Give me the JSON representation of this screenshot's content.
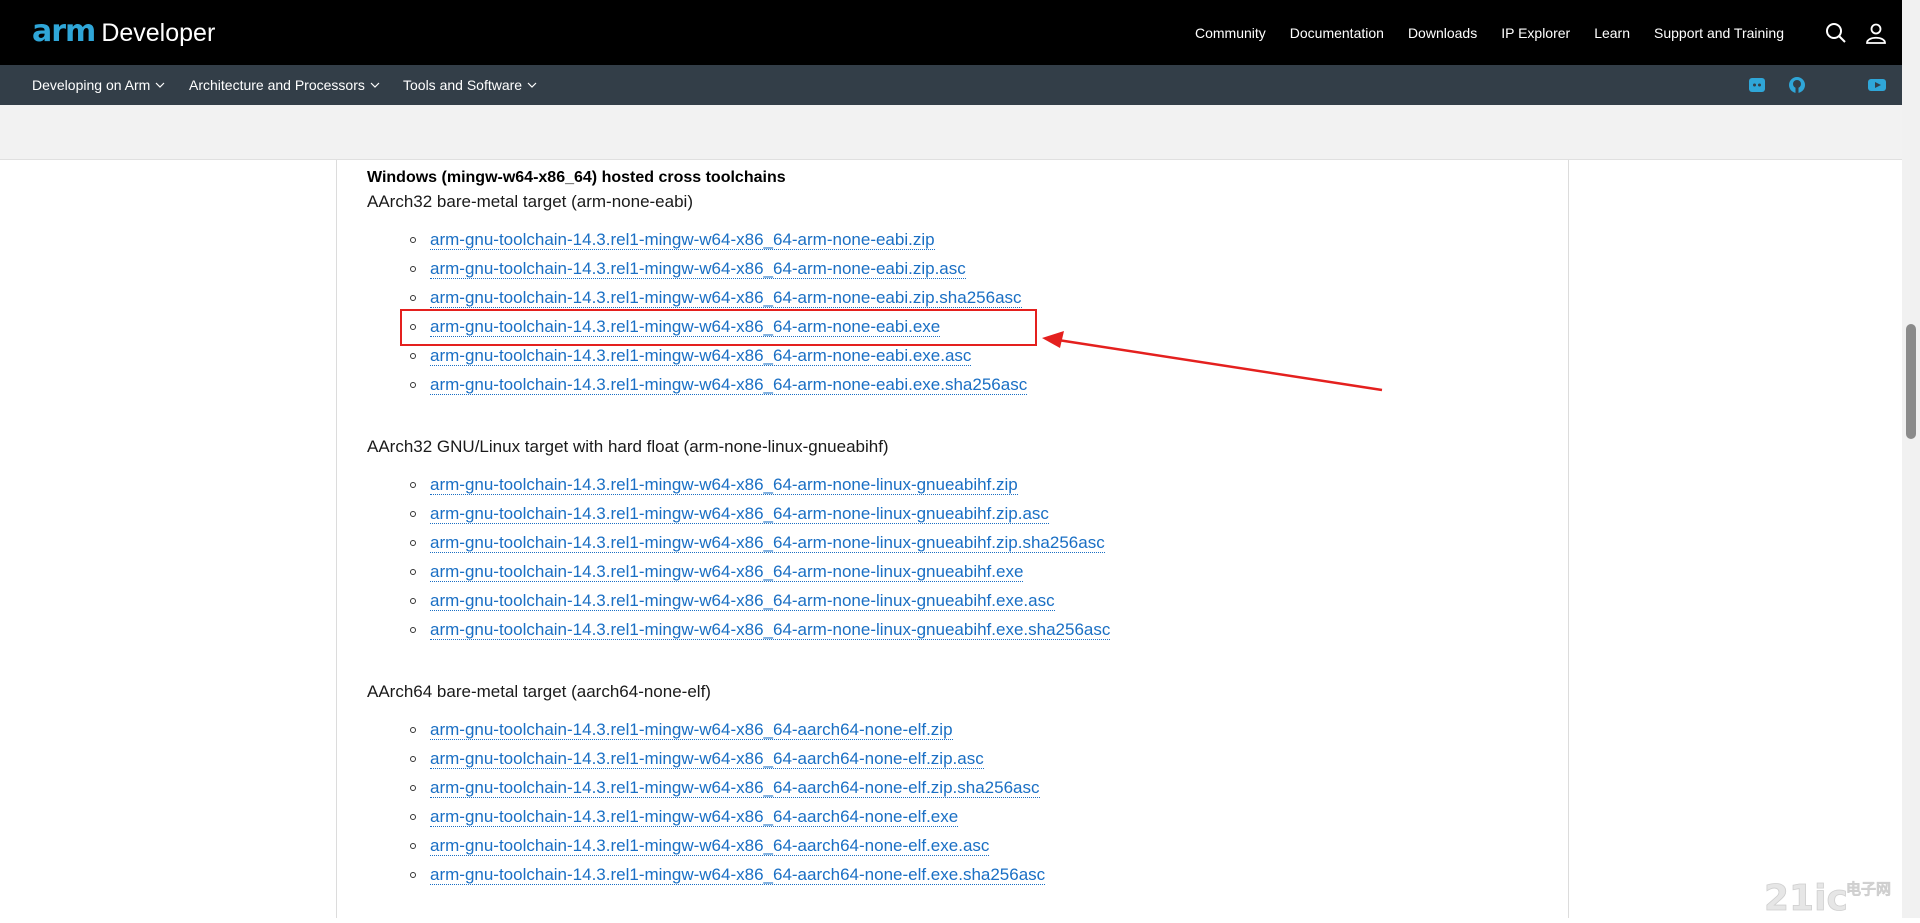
{
  "header": {
    "logo_brand": "arm",
    "logo_product": "Developer",
    "nav": [
      "Community",
      "Documentation",
      "Downloads",
      "IP Explorer",
      "Learn",
      "Support and Training"
    ],
    "icons": [
      "search-icon",
      "user-icon"
    ]
  },
  "subnav": {
    "items": [
      "Developing on Arm",
      "Architecture and Processors",
      "Tools and Software"
    ],
    "social_icons": [
      "discord-icon",
      "github-icon",
      "youtube-icon"
    ]
  },
  "content": {
    "section_title": "Windows (mingw-w64-x86_64) hosted cross toolchains",
    "groups": [
      {
        "title": "AArch32 bare-metal target (arm-none-eabi)",
        "links": [
          "arm-gnu-toolchain-14.3.rel1-mingw-w64-x86_64-arm-none-eabi.zip",
          "arm-gnu-toolchain-14.3.rel1-mingw-w64-x86_64-arm-none-eabi.zip.asc",
          "arm-gnu-toolchain-14.3.rel1-mingw-w64-x86_64-arm-none-eabi.zip.sha256asc",
          "arm-gnu-toolchain-14.3.rel1-mingw-w64-x86_64-arm-none-eabi.exe",
          "arm-gnu-toolchain-14.3.rel1-mingw-w64-x86_64-arm-none-eabi.exe.asc",
          "arm-gnu-toolchain-14.3.rel1-mingw-w64-x86_64-arm-none-eabi.exe.sha256asc"
        ]
      },
      {
        "title": "AArch32 GNU/Linux target with hard float (arm-none-linux-gnueabihf)",
        "links": [
          "arm-gnu-toolchain-14.3.rel1-mingw-w64-x86_64-arm-none-linux-gnueabihf.zip",
          "arm-gnu-toolchain-14.3.rel1-mingw-w64-x86_64-arm-none-linux-gnueabihf.zip.asc",
          "arm-gnu-toolchain-14.3.rel1-mingw-w64-x86_64-arm-none-linux-gnueabihf.zip.sha256asc",
          "arm-gnu-toolchain-14.3.rel1-mingw-w64-x86_64-arm-none-linux-gnueabihf.exe",
          "arm-gnu-toolchain-14.3.rel1-mingw-w64-x86_64-arm-none-linux-gnueabihf.exe.asc",
          "arm-gnu-toolchain-14.3.rel1-mingw-w64-x86_64-arm-none-linux-gnueabihf.exe.sha256asc"
        ]
      },
      {
        "title": "AArch64 bare-metal target (aarch64-none-elf)",
        "links": [
          "arm-gnu-toolchain-14.3.rel1-mingw-w64-x86_64-aarch64-none-elf.zip",
          "arm-gnu-toolchain-14.3.rel1-mingw-w64-x86_64-aarch64-none-elf.zip.asc",
          "arm-gnu-toolchain-14.3.rel1-mingw-w64-x86_64-aarch64-none-elf.zip.sha256asc",
          "arm-gnu-toolchain-14.3.rel1-mingw-w64-x86_64-aarch64-none-elf.exe",
          "arm-gnu-toolchain-14.3.rel1-mingw-w64-x86_64-aarch64-none-elf.exe.asc",
          "arm-gnu-toolchain-14.3.rel1-mingw-w64-x86_64-aarch64-none-elf.exe.sha256asc"
        ]
      }
    ]
  },
  "annotation": {
    "highlight_color": "#e4201e"
  },
  "watermark": {
    "text": "21ic电子网"
  },
  "colors": {
    "link": "#1a6fc4",
    "brand": "#2fa6d8",
    "topbar": "#000000",
    "subnav": "#333e48"
  }
}
